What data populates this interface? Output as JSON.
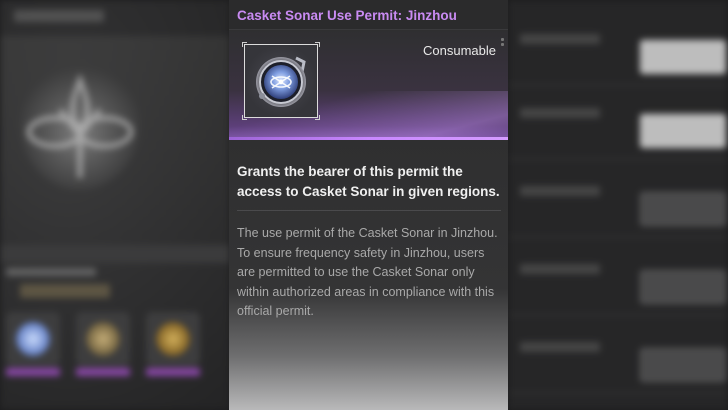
{
  "item": {
    "title": "Casket Sonar Use Permit: Jinzhou",
    "category": "Consumable",
    "icon": "casket-sonar-permit-icon",
    "summary": "Grants the bearer of this permit the access to Casket Sonar in given regions.",
    "description": "The use permit of the Casket Sonar in Jinzhou. To ensure frequency safety in Jinzhou, users are permitted to use the Casket Sonar only within authorized areas in compliance with this official permit."
  },
  "colors": {
    "title": "#c98bf3",
    "rarity_accent": "#c887ff",
    "card_bg": "#2f2f30"
  }
}
